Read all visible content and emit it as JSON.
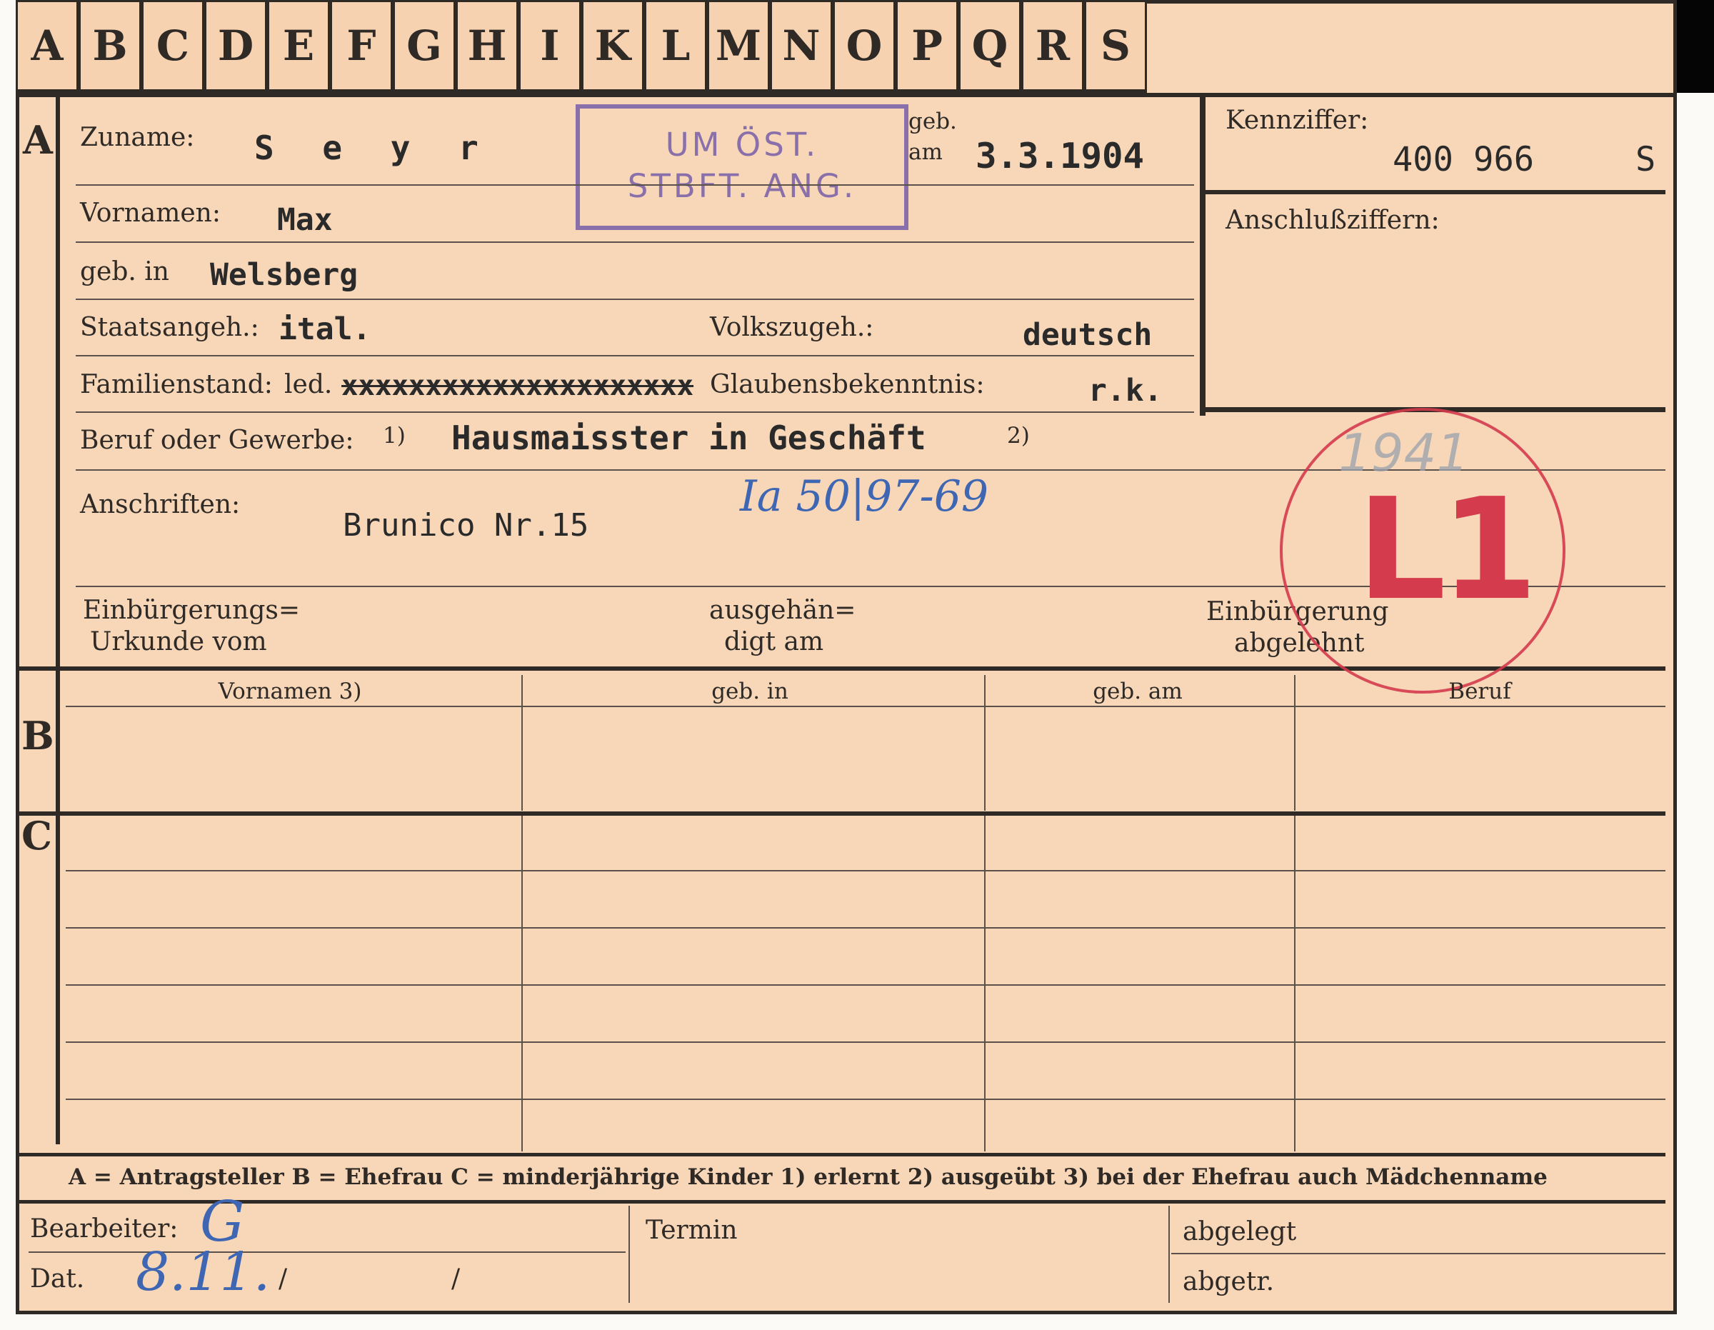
{
  "header": {
    "tabs": [
      "A",
      "B",
      "C",
      "D",
      "E",
      "F",
      "G",
      "H",
      "I",
      "K",
      "L",
      "M",
      "N",
      "O",
      "P",
      "Q",
      "R",
      "S"
    ]
  },
  "section_a": {
    "letter": "A",
    "surname_label": "Zuname:",
    "surname_value": "S e y r",
    "birth_label": "geb.",
    "birth_on_label": "am",
    "birth_date_value": "3.3.1904",
    "stamp_lines": [
      "UM ÖST.",
      "STBFT. ANG."
    ],
    "key_number_label": "Kennziffer:",
    "key_number_value": "400 966",
    "key_number_suffix": "S",
    "connection_numbers_label": "Anschlußziffern:",
    "first_names_label": "Vornamen:",
    "first_names_value": "Max",
    "birthplace_label": "geb. in",
    "birthplace_value": "Welsberg",
    "citizenship_label": "Staatsangeh.:",
    "citizenship_value": "ital.",
    "nationality_label": "Volkszugeh.:",
    "nationality_value": "deutsch",
    "family_status_label": "Familienstand:",
    "family_status_value": "led.",
    "crossed_out_text": "xxxxxxxxxxxxxxxxxxxxx",
    "religion_label": "Glaubensbekenntnis:",
    "religion_value": "r.k.",
    "occupation_label": "Beruf oder Gewerbe:",
    "footnote_1": "1)",
    "occupation_value": "Hausmaisster in Geschäft",
    "footnote_2": "2)",
    "addresses_label": "Anschriften:",
    "address_value": "Brunico Nr.15",
    "file_reference": "Ia 50|97-69",
    "naturalization_doc_label_line1": "Einbürgerungs=",
    "naturalization_doc_label_line2": "Urkunde vom",
    "handed_out_label_line1": "ausgehän=",
    "handed_out_label_line2": "digt am",
    "naturalization_refused_label_line1": "Einbürgerung",
    "naturalization_refused_label_line2": "abgelehnt",
    "red_stamp_year": "1941",
    "red_stamp_code": "L1"
  },
  "section_b": {
    "letter": "B",
    "columns": [
      "Vornamen 3)",
      "geb. in",
      "geb. am",
      "Beruf"
    ]
  },
  "section_c": {
    "letter": "C"
  },
  "legend": {
    "text": "A = Antragsteller   B = Ehefrau   C = minderjährige Kinder   1) erlernt   2) ausgeübt   3) bei der Ehefrau auch Mädchenname"
  },
  "footer": {
    "processor_label": "Bearbeiter:",
    "processor_value": "G",
    "date_label": "Dat.",
    "date_value": "8.11.",
    "date_slash_1": "/",
    "date_slash_2": "/",
    "deadline_label": "Termin",
    "filed_label": "abgelegt",
    "removed_label": "abgetr."
  },
  "colors": {
    "card": "#f7d7b8",
    "ink": "#2f2a26",
    "purple_stamp": "#7b62a9",
    "red_stamp": "#d43b4d",
    "blue_handwriting": "#3f66b2"
  }
}
